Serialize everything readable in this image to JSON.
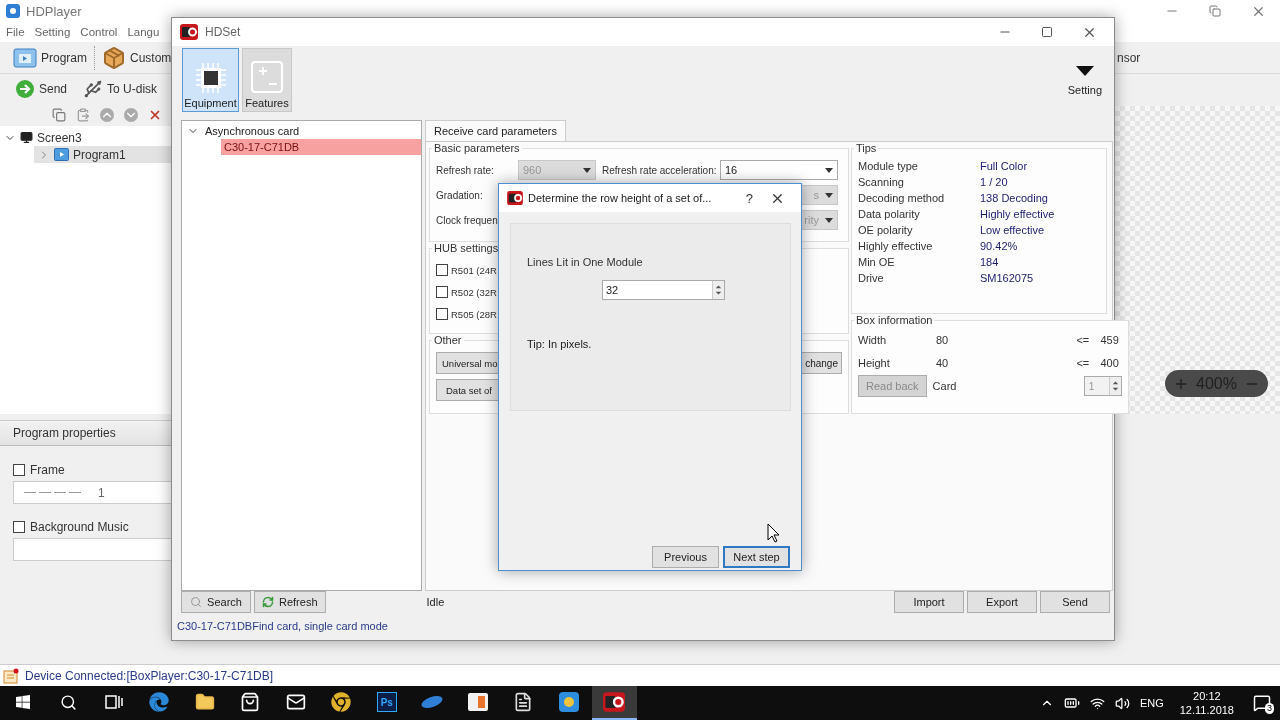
{
  "player": {
    "title": "HDPlayer",
    "menu": [
      "File",
      "Setting",
      "Control",
      "Langu"
    ],
    "toolbar": [
      {
        "label": "Program",
        "kind": "program"
      },
      {
        "label": "Custom",
        "kind": "custom"
      }
    ],
    "toolbar_right": "nsor",
    "actions": [
      {
        "label": "Send",
        "kind": "send"
      },
      {
        "label": "To U-disk",
        "kind": "udisk"
      }
    ],
    "tree": [
      {
        "label": "Screen3",
        "expanded": true,
        "selected": false,
        "children": [
          {
            "label": "Program1",
            "expanded": false,
            "selected": true
          }
        ]
      }
    ],
    "properties": {
      "title": "Program properties",
      "options": [
        {
          "label": "Frame",
          "checked": false,
          "kind": "frame",
          "value": "1"
        },
        {
          "label": "Background Music",
          "checked": false,
          "kind": "music"
        }
      ]
    },
    "zoom": "400%",
    "status": "Device Connected:[BoxPlayer:C30-17-C71DB]"
  },
  "hdset": {
    "title": "HDSet",
    "modes": [
      {
        "label": "Equipment",
        "kind": "equipment",
        "selected": true
      },
      {
        "label": "Features",
        "kind": "features",
        "selected": false
      }
    ],
    "setting": "Setting",
    "devices": [
      {
        "label": "Asynchronous card",
        "expanded": true,
        "selected": false,
        "children": [
          {
            "label": "C30-17-C71DB",
            "selected": true
          }
        ]
      }
    ],
    "tabs": [
      {
        "label": "Receive card parameters",
        "selected": true
      }
    ],
    "basic": {
      "title": "Basic parameters",
      "rows": [
        {
          "label": "Refresh rate:",
          "select": {
            "value": "960",
            "disabled": true
          },
          "label_2": "Refresh rate acceleration:",
          "select_2": {
            "value": "16",
            "disabled": false
          }
        },
        {
          "label": "Gradation:",
          "select_2": {
            "value": "s",
            "disabled": true
          }
        },
        {
          "label": "Clock frequen",
          "select_2": {
            "value": "rity",
            "disabled": true
          }
        }
      ]
    },
    "hub": {
      "title": "HUB settings",
      "options": [
        {
          "label": "R501 (24R",
          "checked": false
        },
        {
          "label": "R502 (32R",
          "checked": false
        },
        {
          "label": "R505 (28R",
          "checked": false
        }
      ]
    },
    "other": {
      "title": "Other",
      "buttons": [
        "Universal mo",
        "Data set of"
      ],
      "button_right": "change"
    },
    "tips": {
      "title": "Tips",
      "rows": [
        {
          "label": "Module type",
          "value": "Full Color"
        },
        {
          "label": "Scanning",
          "value": "1 / 20"
        },
        {
          "label": "Decoding method",
          "value": "138 Decoding"
        },
        {
          "label": "Data polarity",
          "value": "Highly effective"
        },
        {
          "label": "OE polarity",
          "value": "Low effective"
        },
        {
          "label": "Highly effective",
          "value": "90.42%"
        },
        {
          "label": "Min OE",
          "value": "184"
        },
        {
          "label": "Drive",
          "value": "SM162075"
        }
      ]
    },
    "box": {
      "title": "Box information",
      "rows": [
        {
          "label": "Width",
          "value": "80",
          "limit_sign": "<=",
          "limit": "459"
        },
        {
          "label": "Height",
          "value": "40",
          "limit_sign": "<=",
          "limit": "400"
        }
      ],
      "read_back": {
        "label": "Read back",
        "disabled": true
      },
      "card_label": "Card",
      "card": {
        "value": "1",
        "disabled": true
      }
    },
    "buttons": [
      {
        "label": "Search",
        "kind": "search"
      },
      {
        "label": "Refresh",
        "kind": "refresh"
      }
    ],
    "state": "Idle",
    "actions": [
      "Import",
      "Export",
      "Send"
    ],
    "status": "C30-17-C71DBFind card, single card mode"
  },
  "dialog": {
    "title": "Determine the row height of a set of...",
    "help": "?",
    "label": "Lines Lit in One Module",
    "value": "32",
    "tip": "Tip: In pixels.",
    "buttons": [
      {
        "label": "Previous",
        "selected": false
      },
      {
        "label": "Next step",
        "selected": true
      }
    ]
  },
  "taskbar": {
    "apps": [
      {
        "kind": "start",
        "active": false
      },
      {
        "kind": "search",
        "active": false
      },
      {
        "kind": "taskview",
        "active": false
      },
      {
        "kind": "edge",
        "active": false
      },
      {
        "kind": "folder",
        "active": false
      },
      {
        "kind": "store",
        "active": false
      },
      {
        "kind": "mail",
        "active": false
      },
      {
        "kind": "chrome",
        "active": false
      },
      {
        "kind": "ps",
        "label": "Ps",
        "active": false
      },
      {
        "kind": "swoosh",
        "active": false
      },
      {
        "kind": "photos",
        "active": false
      },
      {
        "kind": "file",
        "active": false
      },
      {
        "kind": "media",
        "active": false
      },
      {
        "kind": "hd",
        "active": true
      }
    ],
    "language": "ENG",
    "time": "20:12",
    "date": "12.11.2018",
    "notifications": "3"
  }
}
